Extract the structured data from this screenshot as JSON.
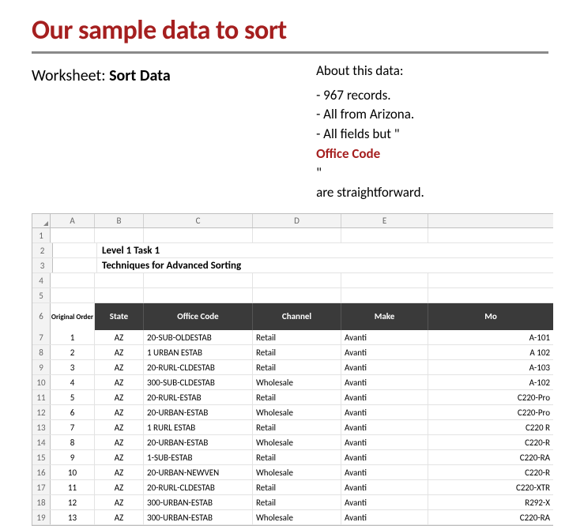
{
  "title": "Our sample data to sort",
  "left": {
    "label": "Worksheet:  ",
    "value": "Sort Data"
  },
  "right": {
    "heading": "About this data:",
    "b1": "- 967 records.",
    "b2": "- All from Arizona.",
    "b3_pre": "- All fields but \"",
    "b3_em": "Office Code",
    "b3_post": "\"",
    "b4": "  are straightforward."
  },
  "col_letters": {
    "a": "A",
    "b": "B",
    "c": "C",
    "d": "D",
    "e": "E"
  },
  "sheet_title1": "Level 1 Task 1",
  "sheet_title2": "Techniques for Advanced Sorting",
  "headers": {
    "a": "Original Order",
    "b": "State",
    "c": "Office Code",
    "d": "Channel",
    "e": "Make",
    "f": "Mo"
  },
  "rownums": [
    "1",
    "2",
    "3",
    "4",
    "5",
    "6",
    "7",
    "8",
    "9",
    "10",
    "11",
    "12",
    "13",
    "14",
    "15",
    "16",
    "17",
    "18",
    "19"
  ],
  "rows": [
    {
      "n": "1",
      "state": "AZ",
      "code": "20-SUB-OLDESTAB",
      "chan": "Retail",
      "make": "Avanti",
      "model": "A-101"
    },
    {
      "n": "2",
      "state": "AZ",
      "code": "1 URBAN ESTAB",
      "chan": "Retail",
      "make": "Avanti",
      "model": "A 102"
    },
    {
      "n": "3",
      "state": "AZ",
      "code": "20-RURL-CLDESTAB",
      "chan": "Retail",
      "make": "Avanti",
      "model": "A-103"
    },
    {
      "n": "4",
      "state": "AZ",
      "code": "300-SUB-CLDESTAB",
      "chan": "Wholesale",
      "make": "Avanti",
      "model": "A-102"
    },
    {
      "n": "5",
      "state": "AZ",
      "code": "20-RURL-ESTAB",
      "chan": "Retail",
      "make": "Avanti",
      "model": "C220-Pro"
    },
    {
      "n": "6",
      "state": "AZ",
      "code": "20-URBAN-ESTAB",
      "chan": "Wholesale",
      "make": "Avanti",
      "model": "C220-Pro"
    },
    {
      "n": "7",
      "state": "AZ",
      "code": "1 RURL ESTAB",
      "chan": "Retail",
      "make": "Avanti",
      "model": "C220 R"
    },
    {
      "n": "8",
      "state": "AZ",
      "code": "20-URBAN-ESTAB",
      "chan": "Wholesale",
      "make": "Avanti",
      "model": "C220-R"
    },
    {
      "n": "9",
      "state": "AZ",
      "code": "1-SUB-ESTAB",
      "chan": "Retail",
      "make": "Avanti",
      "model": "C220-RA"
    },
    {
      "n": "10",
      "state": "AZ",
      "code": "20-URBAN-NEWVEN",
      "chan": "Wholesale",
      "make": "Avanti",
      "model": "C220-R"
    },
    {
      "n": "11",
      "state": "AZ",
      "code": "20-RURL-CLDESTAB",
      "chan": "Retail",
      "make": "Avanti",
      "model": "C220-XTR"
    },
    {
      "n": "12",
      "state": "AZ",
      "code": "300-URBAN-ESTAB",
      "chan": "Retail",
      "make": "Avanti",
      "model": "R292-X"
    },
    {
      "n": "13",
      "state": "AZ",
      "code": "300-URBAN-ESTAB",
      "chan": "Wholesale",
      "make": "Avanti",
      "model": "C220-RA"
    }
  ]
}
